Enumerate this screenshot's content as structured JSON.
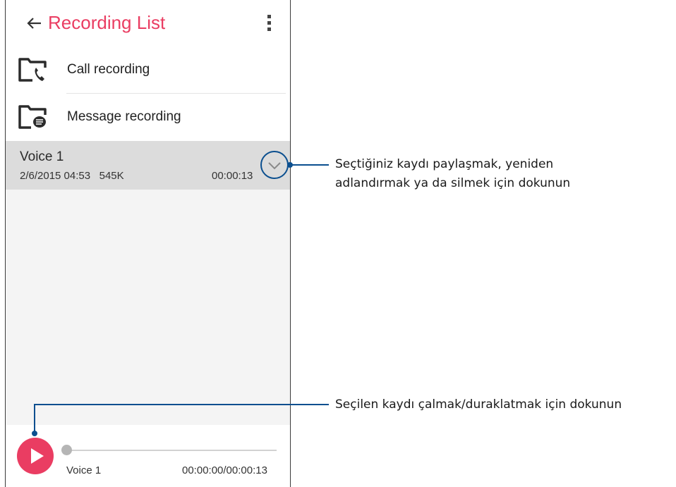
{
  "app_bar": {
    "title": "Recording List",
    "back_icon": "arrow-left-icon",
    "menu_icon": "more-vertical-icon"
  },
  "folders": [
    {
      "label": "Call recording",
      "icon": "call-folder-icon"
    },
    {
      "label": "Message recording",
      "icon": "message-folder-icon"
    }
  ],
  "recordings": [
    {
      "name": "Voice 1",
      "date": "2/6/2015 04:53",
      "size": "545K",
      "duration": "00:00:13",
      "expand_icon": "chevron-down-icon"
    }
  ],
  "player": {
    "play_icon": "play-icon",
    "track_name": "Voice 1",
    "time": "00:00:00/00:00:13",
    "progress": 0
  },
  "callouts": {
    "expand_line1": "Seçtiğiniz kaydı paylaşmak, yeniden",
    "expand_line2": "adlandırmak ya da silmek için dokunun",
    "play": "Seçilen kaydı çalmak/duraklatmak için dokunun"
  },
  "colors": {
    "accent": "#ea3d62",
    "callout_line": "#0b4f8f",
    "selected_row": "#dcdcdc"
  }
}
